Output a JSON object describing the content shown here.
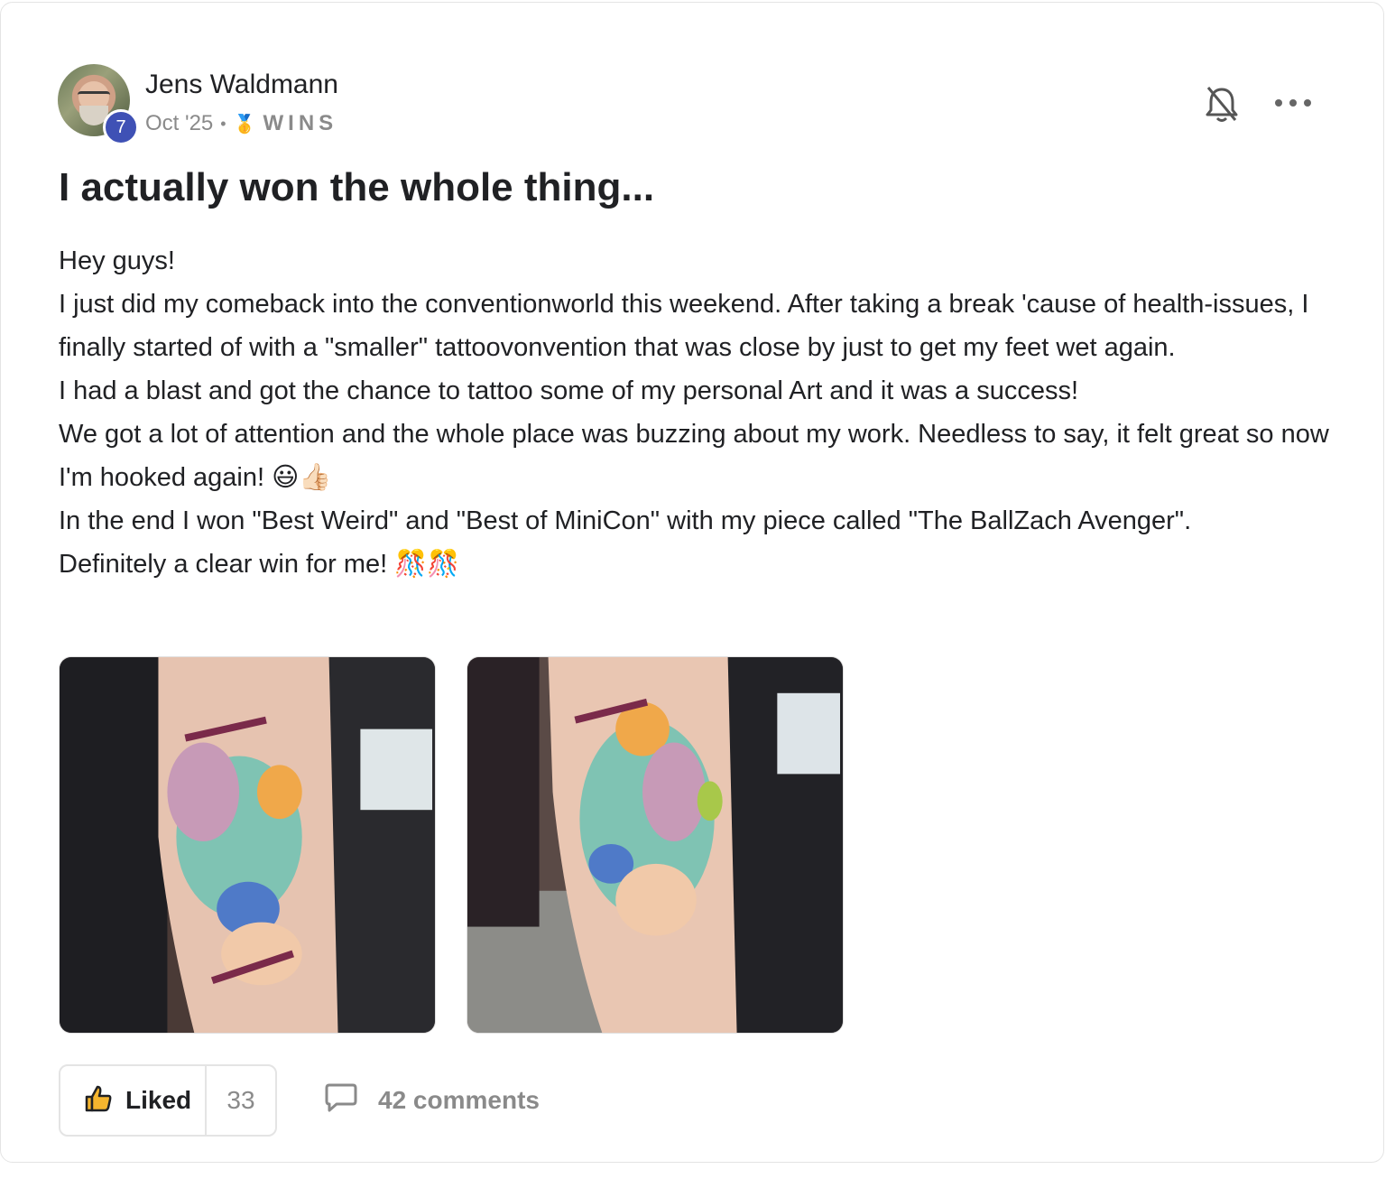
{
  "post": {
    "author": {
      "name": "Jens Waldmann",
      "level": "7",
      "avatar_icon": "user-avatar-photo"
    },
    "date": "Oct '25",
    "separator": "•",
    "category_icon": "medal-icon",
    "category": "WINS",
    "title": "I actually won the whole thing...",
    "body_lines": [
      "Hey guys!",
      "I just did my comeback into the conventionworld this weekend. After taking a break 'cause of health-issues, I finally started of with a \"smaller\" tattoovonvention that was close by just to get my feet wet again.",
      "I had a blast and got the chance to tattoo some of my personal Art and it was a success!",
      "We got a lot of attention and the whole place was buzzing about my work. Needless to say, it felt great so now I'm hooked again! 😃👍🏻",
      "In the end I won \"Best Weird\" and \"Best of MiniCon\" with my piece called \"The BallZach Avenger\".",
      "Definitely a clear win for me! 🎊🎊"
    ],
    "images": [
      {
        "alt": "Tattoo photo 1 - thigh view"
      },
      {
        "alt": "Tattoo photo 2 - shin view"
      }
    ]
  },
  "actions": {
    "like_label": "Liked",
    "like_count": "33",
    "comments_label": "42 comments"
  },
  "colors": {
    "level_badge": "#3f51b5",
    "text": "#202124",
    "muted": "#8a8a8a",
    "border": "#e4e4e4"
  }
}
